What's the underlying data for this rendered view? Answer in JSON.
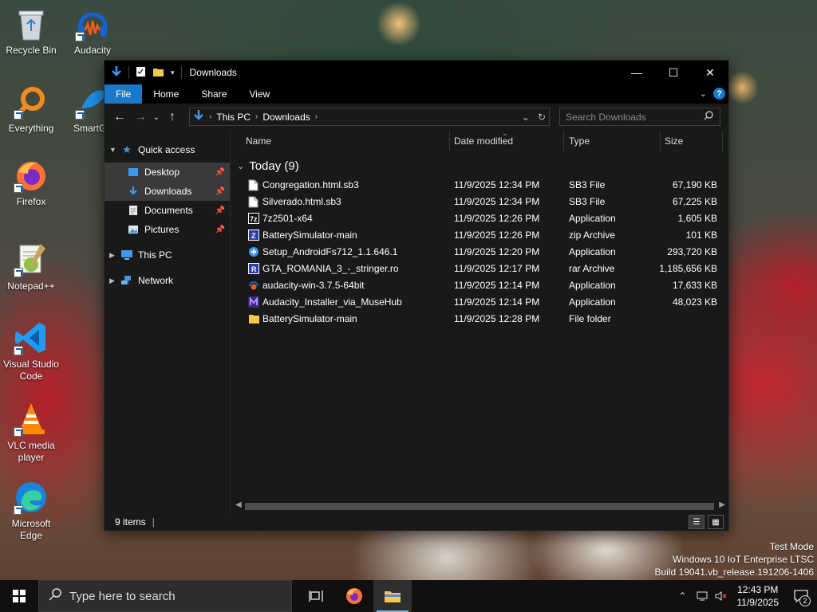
{
  "desktop": {
    "icons": [
      {
        "label": "Recycle Bin",
        "icon": "recycle-bin-icon"
      },
      {
        "label": "Audacity",
        "icon": "audacity-icon"
      },
      {
        "label": "Everything",
        "icon": "everything-search-icon"
      },
      {
        "label": "SmartGa",
        "icon": "smartgaga-icon"
      },
      {
        "label": "Firefox",
        "icon": "firefox-icon"
      },
      {
        "label": "Notepad++",
        "icon": "notepad-plus-plus-icon"
      },
      {
        "label": "Visual Studio Code",
        "icon": "vscode-icon"
      },
      {
        "label": "VLC media player",
        "icon": "vlc-icon"
      },
      {
        "label": "Microsoft Edge",
        "icon": "edge-icon"
      }
    ]
  },
  "window": {
    "title": "Downloads",
    "ribbon_tabs": [
      "File",
      "Home",
      "Share",
      "View"
    ],
    "address": {
      "crumbs": [
        "This PC",
        "Downloads"
      ]
    },
    "search_placeholder": "Search Downloads",
    "nav": {
      "quick_access": "Quick access",
      "items": [
        "Desktop",
        "Downloads",
        "Documents",
        "Pictures"
      ],
      "this_pc": "This PC",
      "network": "Network"
    },
    "columns": {
      "name": "Name",
      "date": "Date modified",
      "type": "Type",
      "size": "Size"
    },
    "group_label": "Today (9)",
    "files": [
      {
        "name": "Congregation.html.sb3",
        "date": "11/9/2025 12:34 PM",
        "type": "SB3 File",
        "size": "67,190 KB",
        "icon": "file-icon"
      },
      {
        "name": "Silverado.html.sb3",
        "date": "11/9/2025 12:34 PM",
        "type": "SB3 File",
        "size": "67,225 KB",
        "icon": "file-icon"
      },
      {
        "name": "7z2501-x64",
        "date": "11/9/2025 12:26 PM",
        "type": "Application",
        "size": "1,605 KB",
        "icon": "7zip-installer-icon"
      },
      {
        "name": "BatterySimulator-main",
        "date": "11/9/2025 12:26 PM",
        "type": "zip Archive",
        "size": "101 KB",
        "icon": "zip-archive-icon"
      },
      {
        "name": "Setup_AndroidFs712_1.1.646.1",
        "date": "11/9/2025 12:20 PM",
        "type": "Application",
        "size": "293,720 KB",
        "icon": "setup-installer-icon"
      },
      {
        "name": "GTA_ROMANIA_3_-_stringer.ro",
        "date": "11/9/2025 12:17 PM",
        "type": "rar Archive",
        "size": "1,185,656 KB",
        "icon": "rar-archive-icon"
      },
      {
        "name": "audacity-win-3.7.5-64bit",
        "date": "11/9/2025 12:14 PM",
        "type": "Application",
        "size": "17,633 KB",
        "icon": "audacity-installer-icon"
      },
      {
        "name": "Audacity_Installer_via_MuseHub",
        "date": "11/9/2025 12:14 PM",
        "type": "Application",
        "size": "48,023 KB",
        "icon": "musehub-installer-icon"
      },
      {
        "name": "BatterySimulator-main",
        "date": "11/9/2025 12:28 PM",
        "type": "File folder",
        "size": "",
        "icon": "folder-icon"
      }
    ],
    "status": "9 items"
  },
  "watermark": {
    "line1": "Test Mode",
    "line2": "Windows 10 IoT Enterprise LTSC",
    "line3": "Build 19041.vb_release.191206-1406"
  },
  "taskbar": {
    "search_placeholder": "Type here to search",
    "time": "12:43 PM",
    "date": "11/9/2025",
    "notifications": "2"
  },
  "colors": {
    "accent": "#1979ca",
    "window_bg": "#191919",
    "taskbar_bg": "#101010"
  }
}
